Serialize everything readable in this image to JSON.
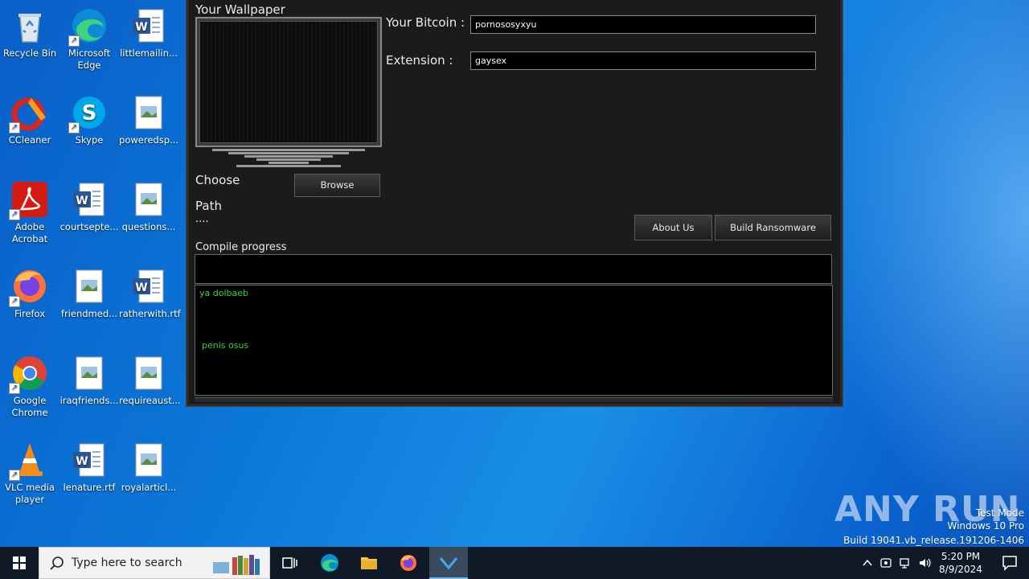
{
  "desktop": {
    "icons": [
      {
        "label": "Recycle Bin",
        "icon": "recycle-bin-icon"
      },
      {
        "label": "Microsoft Edge",
        "icon": "edge-icon"
      },
      {
        "label": "littlemailin...",
        "icon": "word-document-icon"
      },
      {
        "label": "CCleaner",
        "icon": "ccleaner-icon"
      },
      {
        "label": "Skype",
        "icon": "skype-icon"
      },
      {
        "label": "poweredsp...",
        "icon": "image-file-icon"
      },
      {
        "label": "Adobe Acrobat",
        "icon": "acrobat-icon"
      },
      {
        "label": "courtsepte...",
        "icon": "word-document-icon"
      },
      {
        "label": "questions...",
        "icon": "image-file-icon"
      },
      {
        "label": "Firefox",
        "icon": "firefox-icon"
      },
      {
        "label": "friendmed...",
        "icon": "image-file-icon"
      },
      {
        "label": "ratherwith.rtf",
        "icon": "word-document-icon"
      },
      {
        "label": "Google Chrome",
        "icon": "chrome-icon"
      },
      {
        "label": "iraqfriends...",
        "icon": "image-file-icon"
      },
      {
        "label": "requireaust...",
        "icon": "image-file-icon"
      },
      {
        "label": "VLC media player",
        "icon": "vlc-icon"
      },
      {
        "label": "lenature.rtf",
        "icon": "word-document-icon"
      },
      {
        "label": "royalarticl...",
        "icon": "image-file-icon"
      }
    ]
  },
  "app": {
    "wallpaper_label": "Your Wallpaper",
    "bitcoin_label": "Your Bitcoin :",
    "bitcoin_value": "pornososyxyu",
    "extension_label": "Extension :",
    "extension_value": "gaysex",
    "choose_label": "Choose",
    "browse_button": "Browse",
    "path_label": "Path",
    "path_value": "....",
    "about_button": "About Us",
    "build_button": "Build Ransomware",
    "compile_label": "Compile progress",
    "log_line_1": "ya dolbaeb",
    "log_line_2": "penis osus"
  },
  "watermark": {
    "brand": "ANY RUN",
    "line1": "Test Mode",
    "line2": "Windows 10 Pro",
    "line3": "Build 19041.vb_release.191206-1406"
  },
  "taskbar": {
    "search_placeholder": "Type here to search",
    "time": "5:20 PM",
    "date": "8/9/2024"
  },
  "colors": {
    "desktop_blue": "#0b78d8",
    "window_bg": "#1b1b1b",
    "log_text": "#3fd43f"
  }
}
